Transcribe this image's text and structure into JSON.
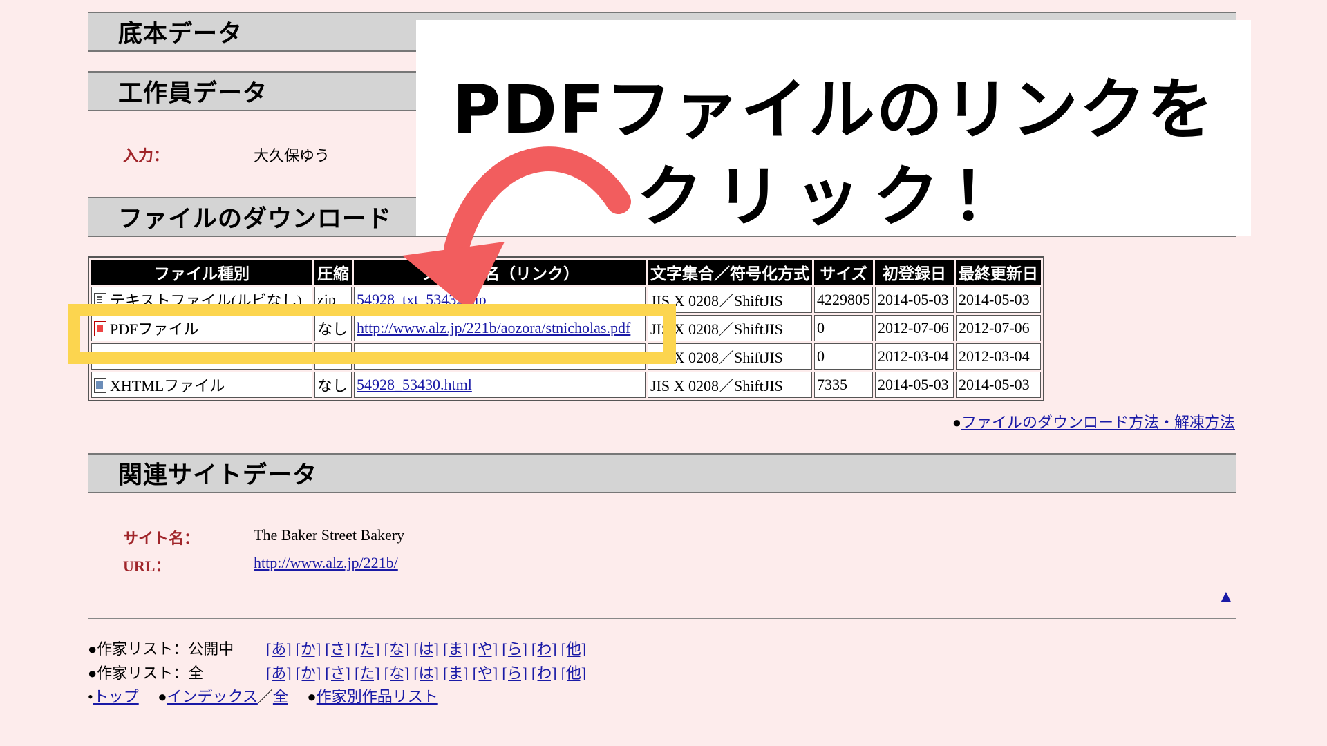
{
  "sections": {
    "teihon": "底本データ",
    "kousakuin": "工作員データ",
    "download": "ファイルのダウンロード",
    "related": "関連サイトデータ"
  },
  "worker": {
    "label": "入力：",
    "value": "大久保ゆう"
  },
  "table": {
    "headers": [
      "ファイル種別",
      "圧縮",
      "ファイル名（リンク）",
      "文字集合／符号化方式",
      "サイズ",
      "初登録日",
      "最終更新日"
    ],
    "rows": [
      {
        "type": "テキストファイル(ルビなし)",
        "comp": "zip",
        "file": "54928_txt_53432.zip",
        "charset": "JIS X 0208／ShiftJIS",
        "size": "4229805",
        "first": "2014-05-03",
        "last": "2014-05-03"
      },
      {
        "type": "PDFファイル",
        "comp": "なし",
        "file": "http://www.alz.jp/221b/aozora/stnicholas.pdf",
        "charset": "JIS X 0208／ShiftJIS",
        "size": "0",
        "first": "2012-07-06",
        "last": "2012-07-06"
      },
      {
        "type": "",
        "comp": "",
        "file": "",
        "charset": "JIS X 0208／ShiftJIS",
        "size": "0",
        "first": "2012-03-04",
        "last": "2012-03-04"
      },
      {
        "type": "XHTMLファイル",
        "comp": "なし",
        "file": "54928_53430.html",
        "charset": "JIS X 0208／ShiftJIS",
        "size": "7335",
        "first": "2014-05-03",
        "last": "2014-05-03"
      }
    ]
  },
  "download_help": {
    "bullet": "●",
    "link": "ファイルのダウンロード方法・解凍方法"
  },
  "site": {
    "name_label": "サイト名：",
    "name_value": "The Baker Street Bakery",
    "url_label": "URL：",
    "url_value": "http://www.alz.jp/221b/"
  },
  "to_top_arrow": "▲",
  "footer": {
    "authors_public_label": "●作家リスト：公開中",
    "authors_all_label": "●作家リスト：全",
    "kana": [
      "[あ]",
      "[か]",
      "[さ]",
      "[た]",
      "[な]",
      "[は]",
      "[ま]",
      "[や]",
      "[ら]",
      "[わ]",
      "[他]"
    ],
    "nav_bullet_small": "•",
    "nav_top": "トップ",
    "nav_bullet": "●",
    "nav_index": "インデックス",
    "nav_sep": "／",
    "nav_all": "全",
    "nav_works": "作家別作品リスト"
  },
  "callout": {
    "line1": "PDFファイルのリンクを",
    "line2": "クリック！"
  },
  "colors": {
    "highlight": "#fcd54f",
    "arrow": "#f25d5e",
    "background": "#fdecec"
  }
}
